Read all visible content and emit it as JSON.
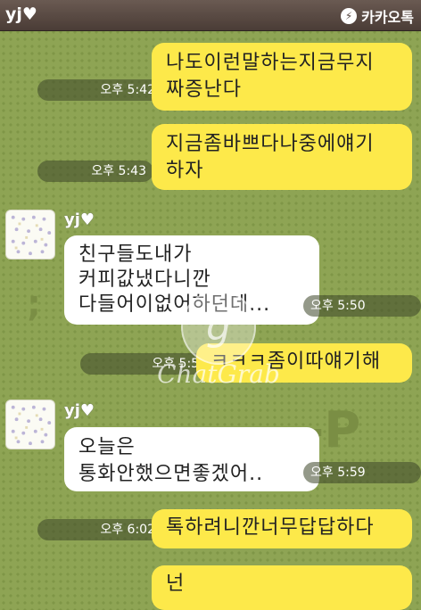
{
  "header": {
    "chat_title": "yj♥",
    "brand": "카카오톡"
  },
  "colors": {
    "background": "#8ea454",
    "my_bubble": "#fde94a",
    "their_bubble": "#ffffff"
  },
  "messages": [
    {
      "sender": "me",
      "text": "나도이런말하는지금무지\n짜증난다",
      "time": "오후 5:42"
    },
    {
      "sender": "me",
      "text": "지금좀바쁘다나중에얘기\n하자",
      "time": "오후 5:43"
    },
    {
      "sender": "them",
      "name": "yj♥",
      "text": "친구들도내가\n커피값냈다니깐\n다들어이없어하던데...",
      "time": "오후 5:50"
    },
    {
      "sender": "me",
      "text": "ㅋㅋㅋ좀이따얘기해",
      "time": "오후 5:51"
    },
    {
      "sender": "them",
      "name": "yj♥",
      "text": "오늘은\n통화안했으면좋겠어..",
      "time": "오후 5:59"
    },
    {
      "sender": "me",
      "text": "톡하려니깐너무답답하다",
      "time": "오후 6:02"
    },
    {
      "sender": "me",
      "text": "넌",
      "time": ""
    }
  ],
  "watermark": {
    "text": "ChatGrab",
    "glyph": "g"
  },
  "background_deco": {
    "left": ";",
    "right": "-P"
  }
}
